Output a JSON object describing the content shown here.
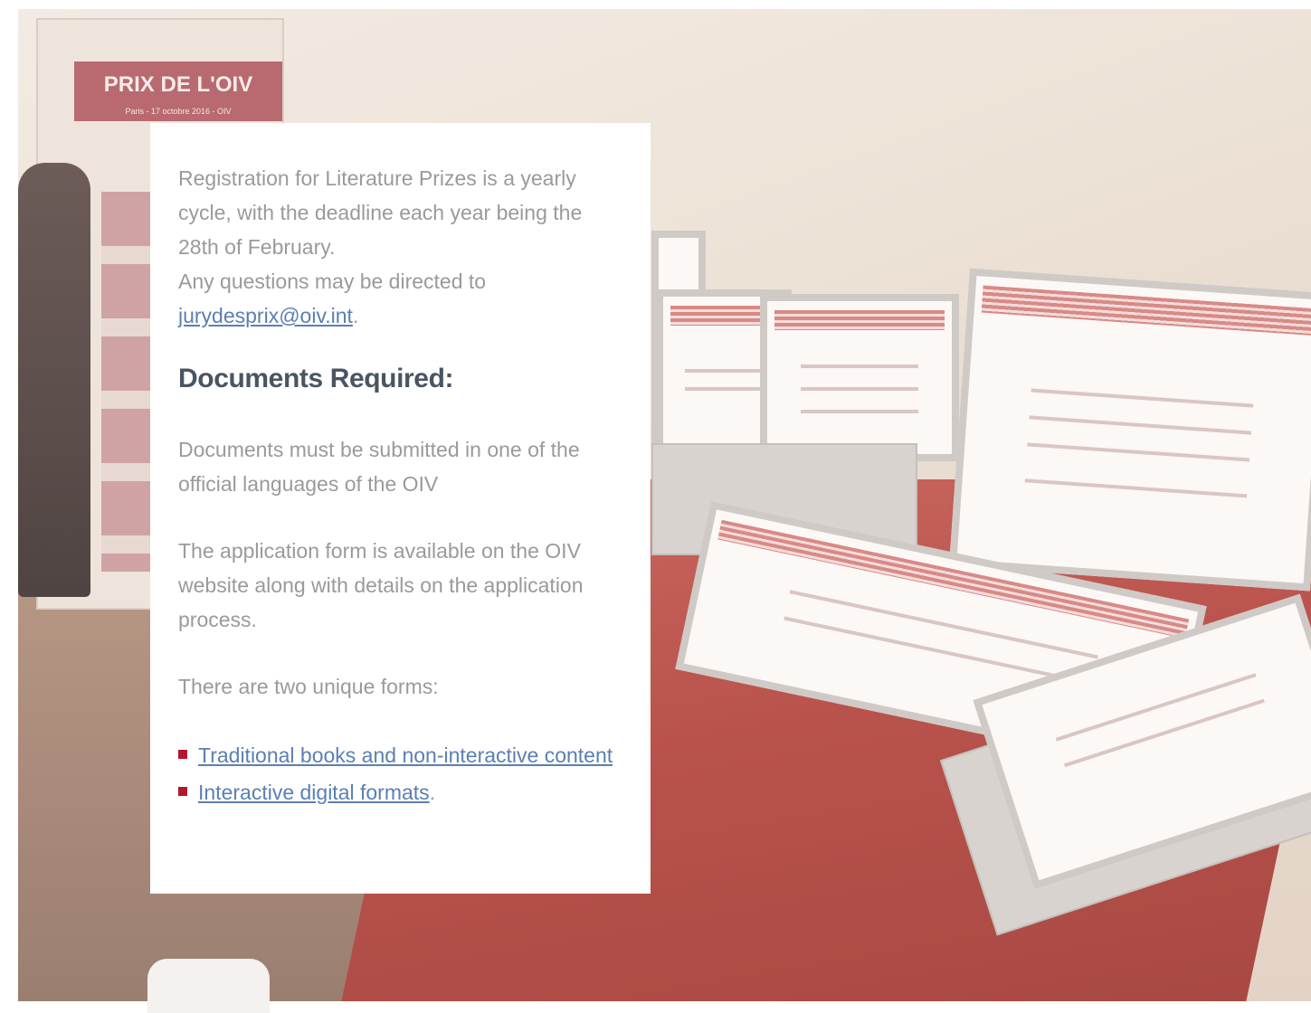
{
  "banner": {
    "title": "PRIX DE L'OIV",
    "subtitle": "Paris - 17 octobre 2016 - OIV"
  },
  "info": {
    "intro": "Registration for Literature Prizes is a yearly cycle, with the deadline each year being the 28th of February.",
    "questions_prefix": "Any questions may be directed to",
    "email": "jurydesprix@oiv.int",
    "email_suffix": "."
  },
  "documents": {
    "heading": "Documents Required:",
    "language_note": "Documents must be submitted in one of the official languages of the OIV",
    "form_note": "The application form is available on the OIV website along with details on the application process.",
    "forms_intro": "There are two unique forms:",
    "forms": [
      {
        "label": "Traditional books and non-interactive content",
        "suffix": ""
      },
      {
        "label": "Interactive digital formats",
        "suffix": "."
      }
    ]
  },
  "colors": {
    "bullet": "#b3172c",
    "link": "#5b7fb3",
    "heading": "#4a5563",
    "body_text": "#9a9a9a"
  },
  "icons": [
    "square-bullet-icon"
  ]
}
